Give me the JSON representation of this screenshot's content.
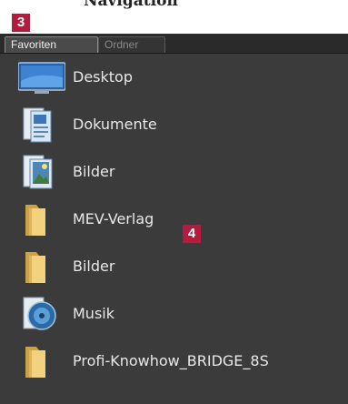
{
  "heading": "Navigation",
  "callouts": [
    "3",
    "4"
  ],
  "tabs": [
    {
      "label": "Favoriten",
      "active": true
    },
    {
      "label": "Ordner",
      "active": false
    }
  ],
  "favorites": [
    {
      "label": "Desktop",
      "icon": "desktop-icon"
    },
    {
      "label": "Dokumente",
      "icon": "documents-icon"
    },
    {
      "label": "Bilder",
      "icon": "pictures-icon"
    },
    {
      "label": "MEV-Verlag",
      "icon": "folder-icon"
    },
    {
      "label": "Bilder",
      "icon": "folder-icon"
    },
    {
      "label": "Musik",
      "icon": "music-icon"
    },
    {
      "label": "Profi-Knowhow_BRIDGE_8S",
      "icon": "folder-icon"
    }
  ],
  "colors": {
    "panel": "#3b3b3b",
    "callout": "#b21c3d",
    "text": "#e8e8e8",
    "folder": "#e9c46a"
  }
}
